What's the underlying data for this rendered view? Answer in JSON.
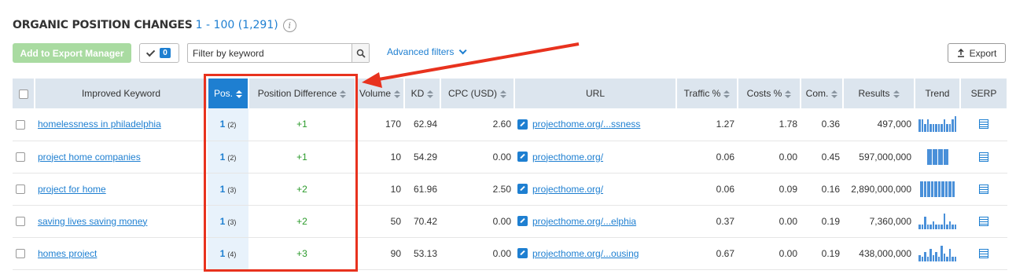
{
  "header": {
    "title": "ORGANIC POSITION CHANGES",
    "range": "1 - 100 (1,291)",
    "info_glyph": "i"
  },
  "toolbar": {
    "export_manager_label": "Add to Export Manager",
    "selected_count": "0",
    "filter_placeholder": "Filter by keyword",
    "advanced_filters_label": "Advanced filters",
    "export_label": "Export"
  },
  "columns": {
    "keyword": "Improved Keyword",
    "pos": "Pos.",
    "diff": "Position Difference",
    "volume": "Volume",
    "kd": "KD",
    "cpc": "CPC (USD)",
    "url": "URL",
    "traffic": "Traffic %",
    "costs": "Costs %",
    "com": "Com.",
    "results": "Results",
    "trend": "Trend",
    "serp": "SERP"
  },
  "rows": [
    {
      "keyword": "homelessness in philadelphia",
      "pos": "1",
      "prev": "(2)",
      "diff": "+1",
      "volume": "170",
      "kd": "62.94",
      "cpc": "2.60",
      "url": "projecthome.org/...ssness",
      "traffic": "1.27",
      "costs": "1.78",
      "com": "0.36",
      "results": "497,000",
      "trend": [
        0.8,
        0.8,
        0.5,
        0.8,
        0.5,
        0.5,
        0.5,
        0.5,
        0.5,
        0.8,
        0.5,
        0.5,
        0.8,
        1.0
      ]
    },
    {
      "keyword": "project home companies",
      "pos": "1",
      "prev": "(2)",
      "diff": "+1",
      "volume": "10",
      "kd": "54.29",
      "cpc": "0.00",
      "url": "projecthome.org/",
      "traffic": "0.06",
      "costs": "0.00",
      "com": "0.45",
      "results": "597,000,000",
      "trend": [
        1.0,
        1.0,
        1.0,
        1.0
      ]
    },
    {
      "keyword": "project for home",
      "pos": "1",
      "prev": "(3)",
      "diff": "+2",
      "volume": "10",
      "kd": "61.96",
      "cpc": "2.50",
      "url": "projecthome.org/",
      "traffic": "0.06",
      "costs": "0.09",
      "com": "0.16",
      "results": "2,890,000,000",
      "trend": [
        1.0,
        1.0,
        1.0,
        1.0,
        1.0,
        1.0,
        1.0,
        1.0,
        1.0,
        1.0
      ]
    },
    {
      "keyword": "saving lives saving money",
      "pos": "1",
      "prev": "(3)",
      "diff": "+2",
      "volume": "50",
      "kd": "70.42",
      "cpc": "0.00",
      "url": "projecthome.org/...elphia",
      "traffic": "0.37",
      "costs": "0.00",
      "com": "0.19",
      "results": "7,360,000",
      "trend": [
        0.3,
        0.3,
        0.8,
        0.3,
        0.3,
        0.5,
        0.3,
        0.3,
        0.3,
        1.0,
        0.3,
        0.5,
        0.3,
        0.3
      ]
    },
    {
      "keyword": "homes project",
      "pos": "1",
      "prev": "(4)",
      "diff": "+3",
      "volume": "90",
      "kd": "53.13",
      "cpc": "0.00",
      "url": "projecthome.org/...ousing",
      "traffic": "0.67",
      "costs": "0.00",
      "com": "0.19",
      "results": "438,000,000",
      "trend": [
        0.4,
        0.3,
        0.6,
        0.3,
        0.8,
        0.4,
        0.6,
        0.3,
        1.0,
        0.5,
        0.3,
        0.8,
        0.3,
        0.3
      ]
    }
  ],
  "colors": {
    "accent": "#1e7fd1",
    "highlight": "#e8321e",
    "positive": "#2a9a2a",
    "export_button": "#a9dba1"
  }
}
